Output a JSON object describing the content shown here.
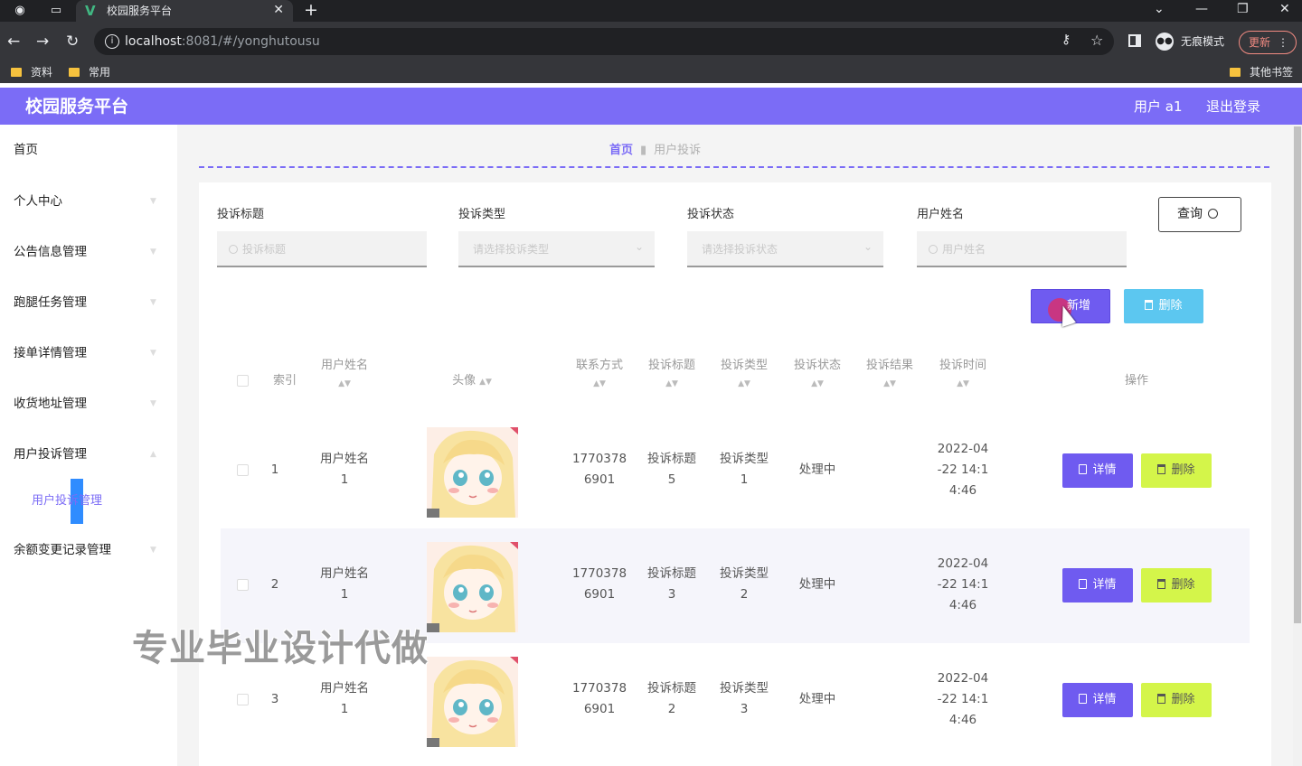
{
  "browser": {
    "tab_title": "校园服务平台",
    "url_host": "localhost",
    "url_rest": ":8081/#/yonghutousu",
    "incognito_label": "无痕模式",
    "update_label": "更新",
    "bookmarks": [
      "资料",
      "常用"
    ],
    "other_bookmarks": "其他书签"
  },
  "header": {
    "title": "校园服务平台",
    "user": "用户 a1",
    "logout": "退出登录"
  },
  "sidebar": {
    "items": [
      "首页",
      "个人中心",
      "公告信息管理",
      "跑腿任务管理",
      "接单详情管理",
      "收货地址管理",
      "用户投诉管理",
      "余额变更记录管理"
    ],
    "active_sub": "用户投诉管理"
  },
  "breadcrumb": {
    "home": "首页",
    "current": "用户投诉"
  },
  "filters": {
    "title": {
      "label": "投诉标题",
      "placeholder": "投诉标题"
    },
    "type": {
      "label": "投诉类型",
      "placeholder": "请选择投诉类型"
    },
    "status": {
      "label": "投诉状态",
      "placeholder": "请选择投诉状态"
    },
    "username": {
      "label": "用户姓名",
      "placeholder": "用户姓名"
    },
    "query_label": "查询"
  },
  "actions": {
    "add_label": "新增",
    "delete_label": "删除"
  },
  "table": {
    "headers": {
      "index": "索引",
      "username": "用户姓名",
      "avatar": "头像",
      "phone": "联系方式",
      "title": "投诉标题",
      "type": "投诉类型",
      "status": "投诉状态",
      "result": "投诉结果",
      "time": "投诉时间",
      "ops": "操作"
    },
    "rows": [
      {
        "index": "1",
        "username": [
          "用户姓名",
          "1"
        ],
        "phone": [
          "1770378",
          "6901"
        ],
        "title": [
          "投诉标题",
          "5"
        ],
        "type": [
          "投诉类型",
          "1"
        ],
        "status": "处理中",
        "result": "",
        "time": [
          "2022-04",
          "-22 14:1",
          "4:46"
        ]
      },
      {
        "index": "2",
        "username": [
          "用户姓名",
          "1"
        ],
        "phone": [
          "1770378",
          "6901"
        ],
        "title": [
          "投诉标题",
          "3"
        ],
        "type": [
          "投诉类型",
          "2"
        ],
        "status": "处理中",
        "result": "",
        "time": [
          "2022-04",
          "-22 14:1",
          "4:46"
        ]
      },
      {
        "index": "3",
        "username": [
          "用户姓名",
          "1"
        ],
        "phone": [
          "1770378",
          "6901"
        ],
        "title": [
          "投诉标题",
          "2"
        ],
        "type": [
          "投诉类型",
          "3"
        ],
        "status": "处理中",
        "result": "",
        "time": [
          "2022-04",
          "-22 14:1",
          "4:46"
        ]
      }
    ],
    "detail_label": "详情",
    "delete_label": "删除"
  },
  "watermark": "专业毕业设计代做"
}
